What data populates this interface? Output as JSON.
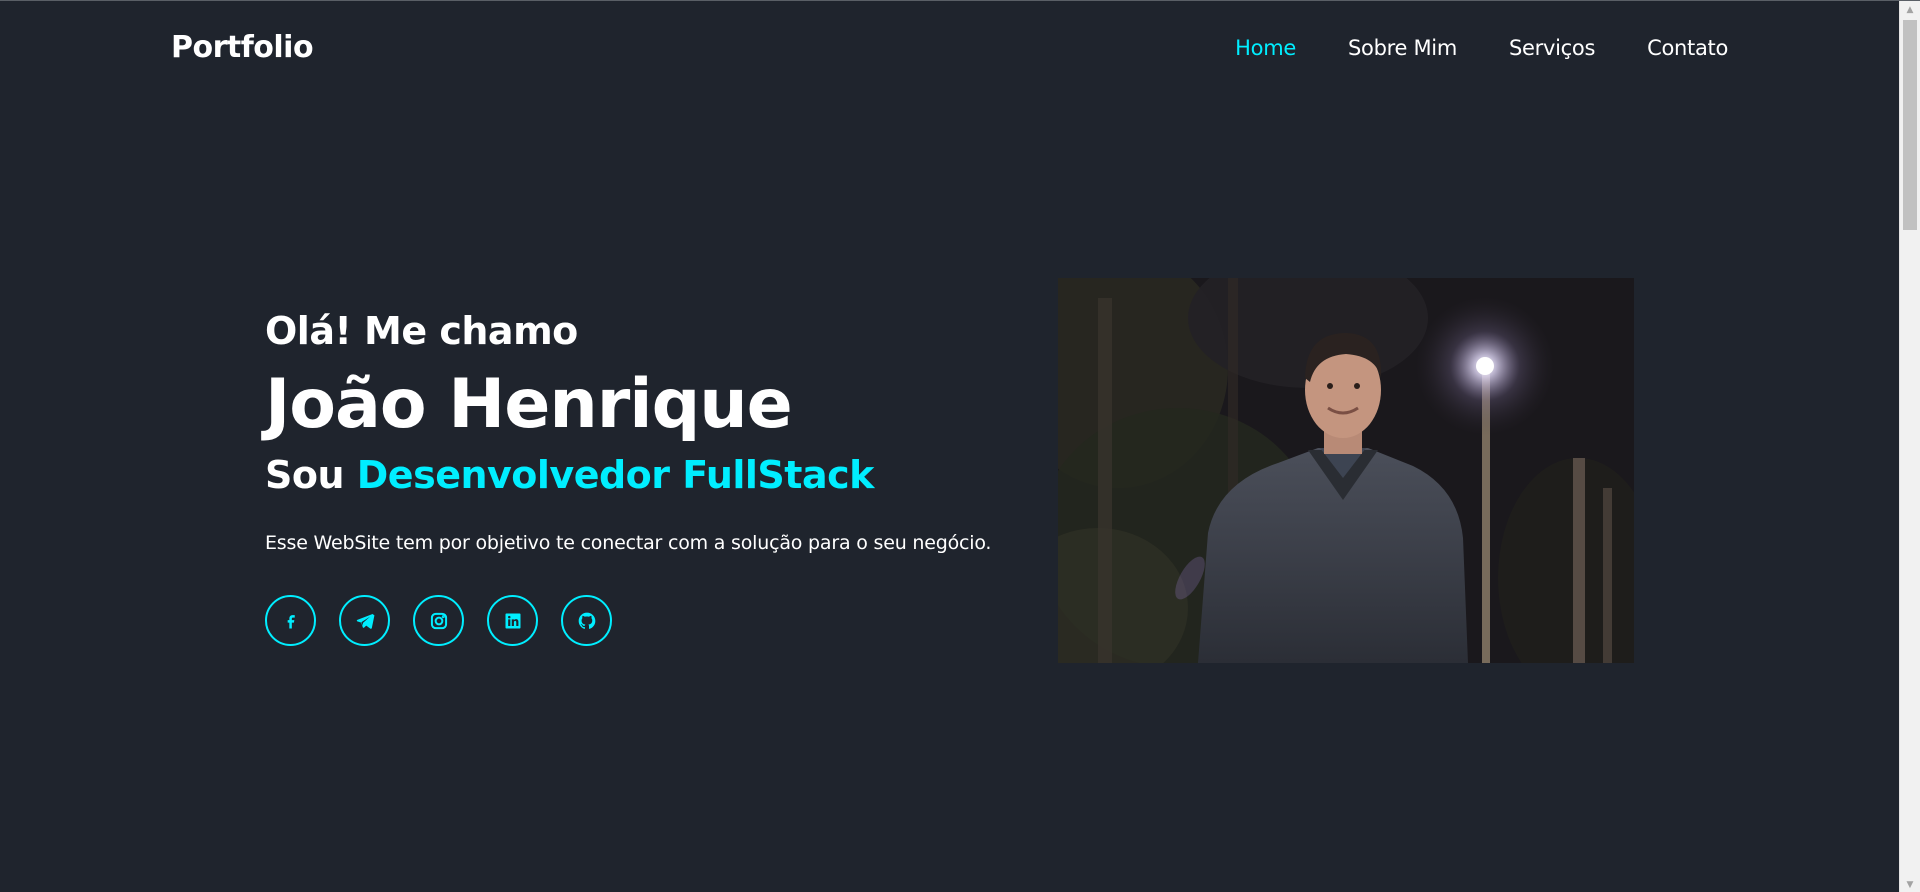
{
  "header": {
    "logo": "Portfolio",
    "nav": [
      {
        "label": "Home",
        "active": true
      },
      {
        "label": "Sobre Mim",
        "active": false
      },
      {
        "label": "Serviços",
        "active": false
      },
      {
        "label": "Contato",
        "active": false
      }
    ]
  },
  "hero": {
    "greeting": "Olá! Me chamo",
    "name": "João Henrique",
    "role_prefix": "Sou ",
    "role_highlight": "Desenvolvedor FullStack",
    "description": "Esse WebSite tem por objetivo te conectar com a solução para o seu negócio.",
    "socials": [
      {
        "icon": "facebook-icon"
      },
      {
        "icon": "telegram-icon"
      },
      {
        "icon": "instagram-icon"
      },
      {
        "icon": "linkedin-icon"
      },
      {
        "icon": "github-icon"
      }
    ]
  },
  "colors": {
    "background": "#1f242d",
    "accent": "#00eeff",
    "text": "#ffffff"
  }
}
